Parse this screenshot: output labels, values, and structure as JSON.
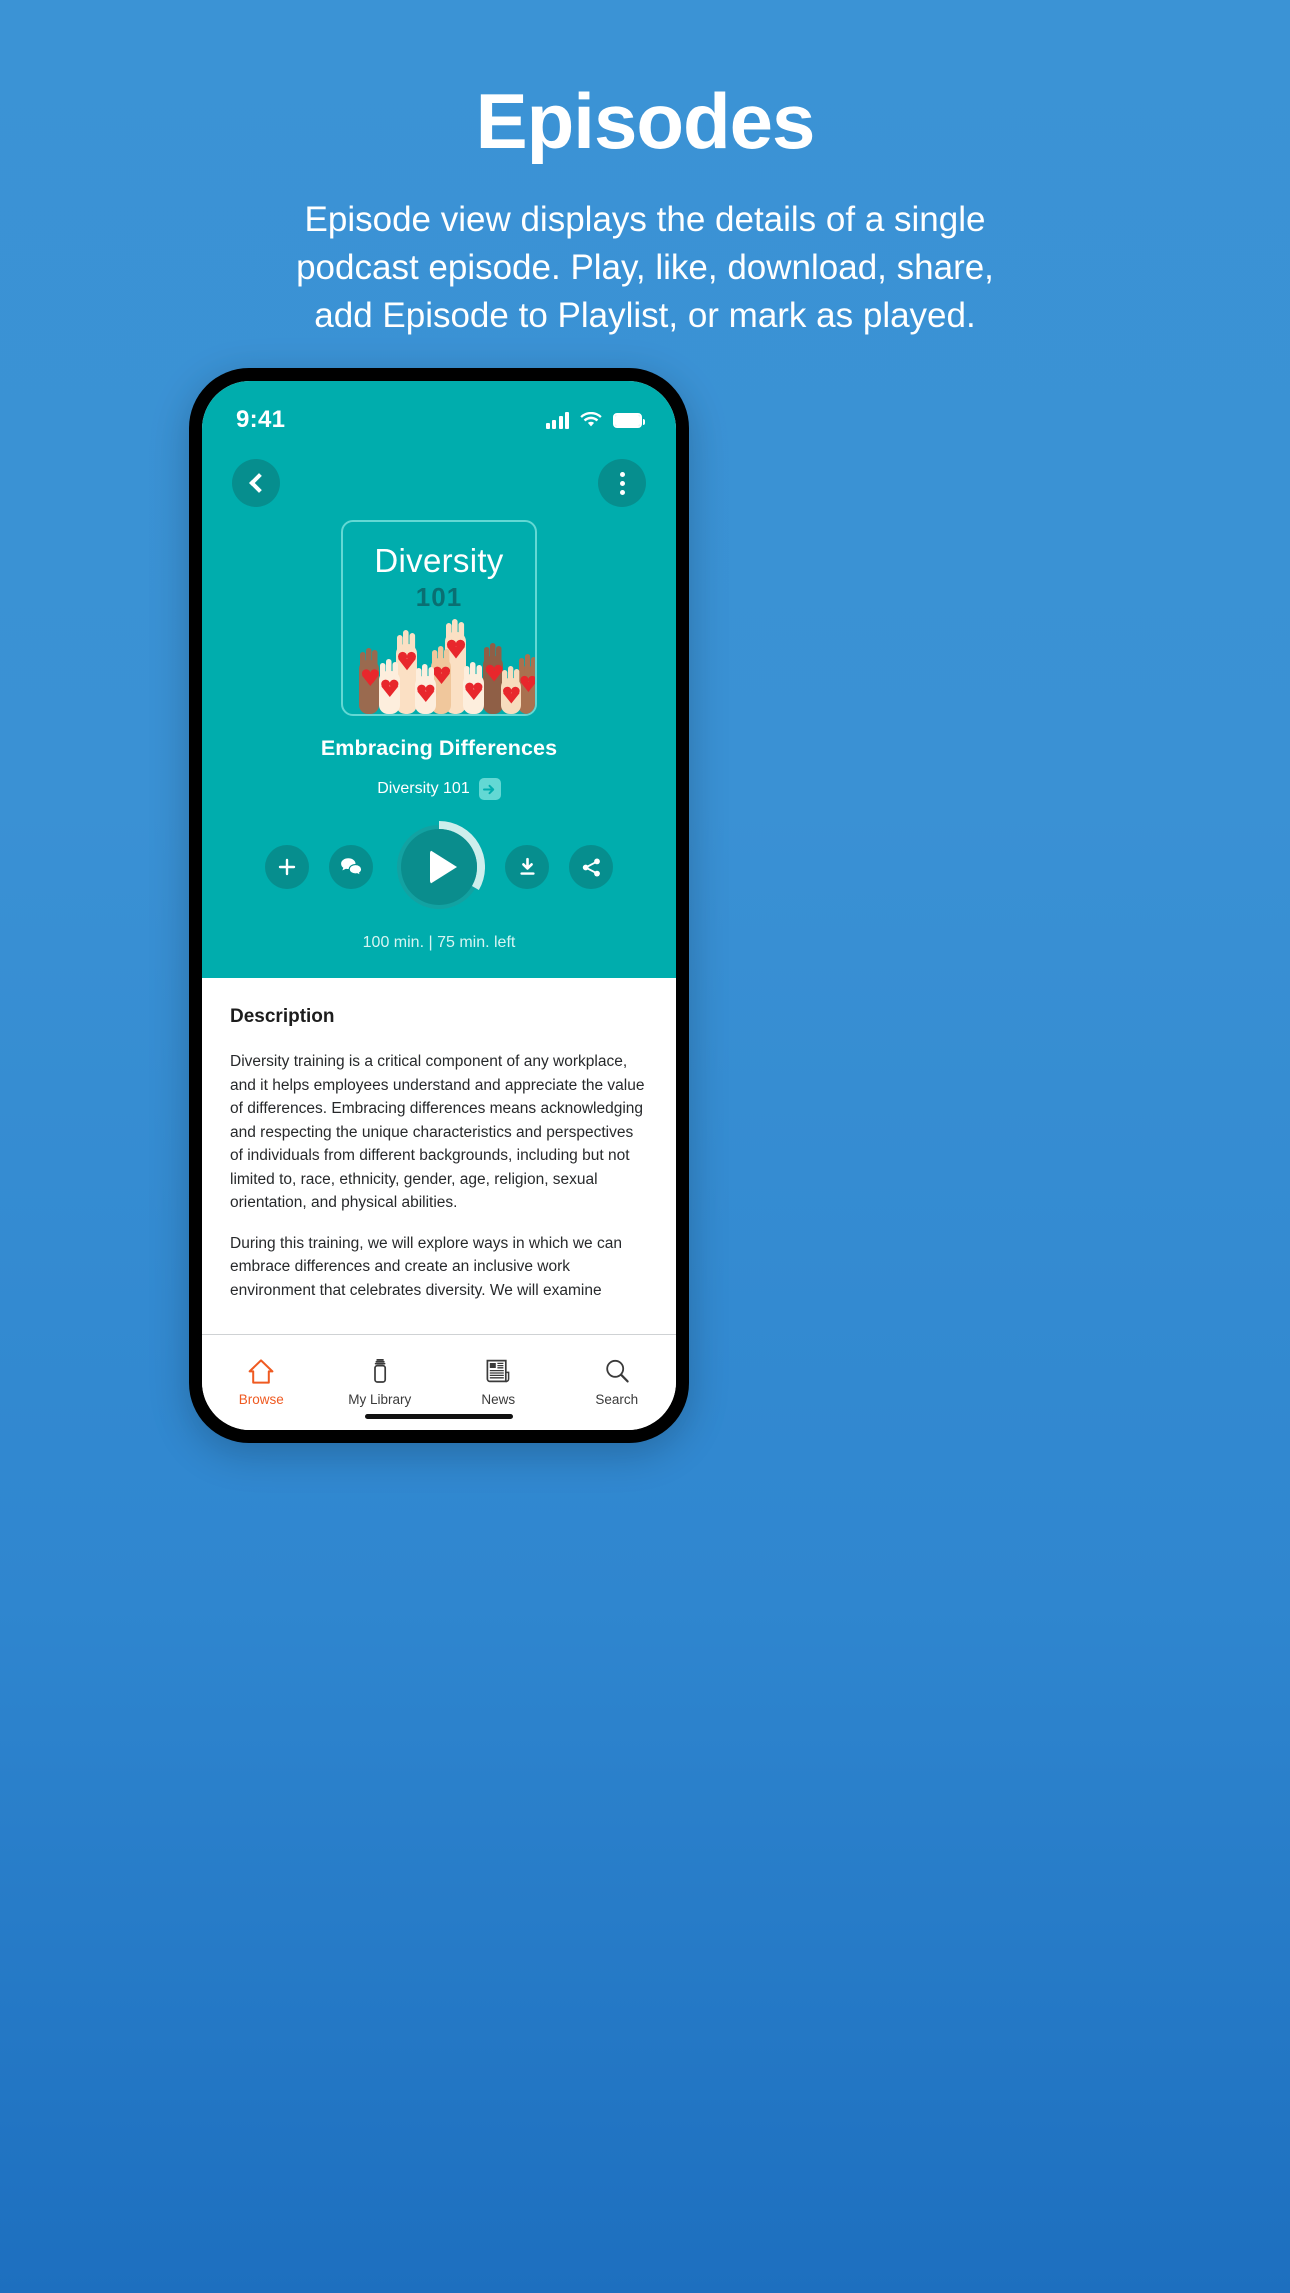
{
  "promo": {
    "title": "Episodes",
    "subtitle": "Episode view displays the details of a single podcast episode. Play, like, download, share, add Episode to Playlist, or mark as played."
  },
  "colors": {
    "page_background_blue": "#3b93d5",
    "hero_teal": "#00adad",
    "button_teal_dark": "#068e8e",
    "accent_orange": "#ef5a21",
    "art_border": "#63d8d4",
    "heart_red": "#e8272c"
  },
  "phone": {
    "statusbar": {
      "time": "9:41",
      "cellular_icon": "signal-bars-icon",
      "wifi_icon": "wifi-icon",
      "battery_icon": "battery-icon"
    },
    "nav": {
      "back_icon": "chevron-left-icon",
      "more_icon": "overflow-menu-icon"
    },
    "artwork": {
      "title": "Diversity",
      "number": "101",
      "illustration": "raised-hands-with-hearts-illustration"
    },
    "episode": {
      "title": "Embracing Differences",
      "show": "Diversity 101",
      "show_link_icon": "open-show-icon",
      "duration": "100 min. | 75 min. left",
      "progress_percent": 25
    },
    "actions": [
      {
        "name": "add-to-playlist",
        "icon": "plus-icon"
      },
      {
        "name": "comments",
        "icon": "chat-bubbles-icon"
      },
      {
        "name": "play",
        "icon": "play-icon"
      },
      {
        "name": "download",
        "icon": "download-icon"
      },
      {
        "name": "share",
        "icon": "share-icon"
      }
    ],
    "description": {
      "heading": "Description",
      "paragraphs": [
        "Diversity training is a critical component of any workplace, and it helps employees understand and appreciate the value of differences. Embracing differences means acknowledging and respecting the unique characteristics and perspectives of individuals from different backgrounds, including but not limited to, race, ethnicity, gender, age, religion, sexual orientation, and physical abilities.",
        "During this training, we will explore ways in which we can embrace differences and create an inclusive work environment that celebrates diversity. We will examine"
      ]
    },
    "tabs": [
      {
        "label": "Browse",
        "icon": "home-icon",
        "active": true
      },
      {
        "label": "My Library",
        "icon": "library-icon",
        "active": false
      },
      {
        "label": "News",
        "icon": "newspaper-icon",
        "active": false
      },
      {
        "label": "Search",
        "icon": "search-icon",
        "active": false
      }
    ]
  }
}
